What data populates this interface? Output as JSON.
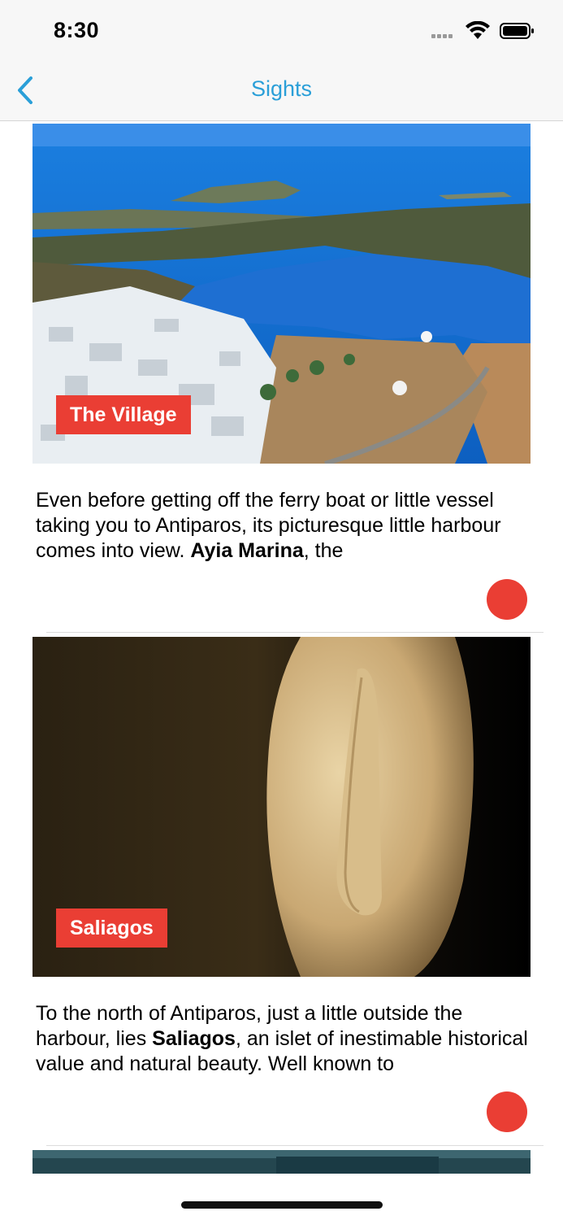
{
  "status_bar": {
    "time": "8:30"
  },
  "nav": {
    "title": "Sights",
    "back_icon": "chevron-left-icon"
  },
  "colors": {
    "accent": "#2a9fd8",
    "label_bg": "#ea3e34",
    "dot": "#ea3e34"
  },
  "cards": [
    {
      "label": "The Village",
      "text_before": "Even before getting off the ferry boat or little vessel taking you to Antiparos, its picturesque little harbour comes into view. ",
      "text_bold": "Ayia Marina",
      "text_after": ", the"
    },
    {
      "label": "Saliagos",
      "text_before": "To the north of Antiparos, just a little outside the harbour, lies ",
      "text_bold": "Saliagos",
      "text_after": ", an islet of inestimable historical value and natural beauty. Well known to"
    }
  ]
}
